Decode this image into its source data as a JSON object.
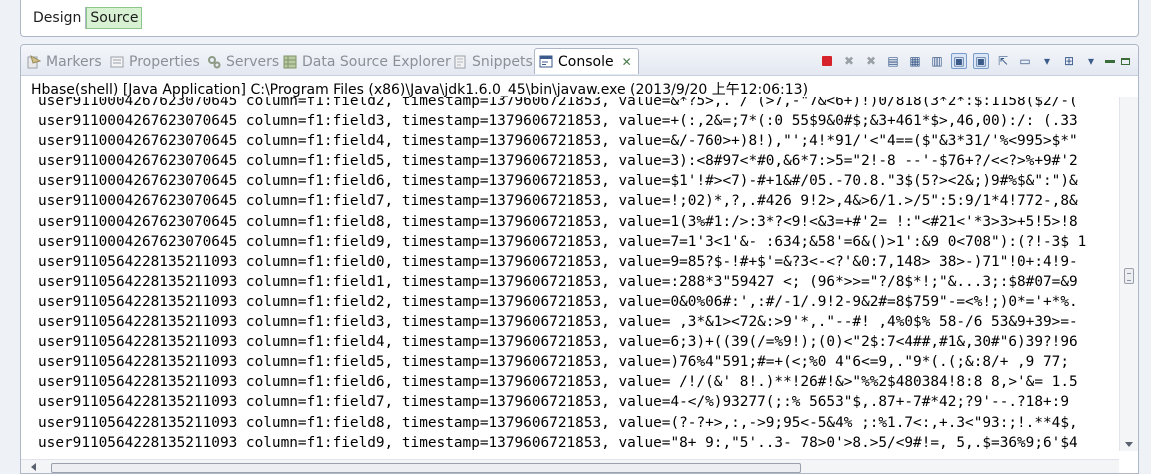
{
  "editor": {
    "tabs": [
      "Design",
      "Source"
    ],
    "active_tab": "Source"
  },
  "view_tabs": [
    {
      "label": "Markers",
      "icon": "markers-icon"
    },
    {
      "label": "Properties",
      "icon": "properties-icon"
    },
    {
      "label": "Servers",
      "icon": "servers-icon"
    },
    {
      "label": "Data Source Explorer",
      "icon": "data-source-explorer-icon"
    },
    {
      "label": "Snippets",
      "icon": "snippets-icon"
    },
    {
      "label": "Console",
      "icon": "console-icon",
      "active": true
    }
  ],
  "console": {
    "launch_title": "Hbase(shell) [Java Application] C:\\Program Files (x86)\\Java\\jdk1.6.0_45\\bin\\javaw.exe (2013/9/20 上午12:06:13)",
    "lines": [
      "user9110004267623070645 column=f1:field2, timestamp=1379606721853, value=&*?5>,. /`(>7,-\"7&<6+)!)0/818(3*2*:$:1158($2/-(",
      "user9110004267623070645 column=f1:field3, timestamp=1379606721853, value=+(:,2&=;7*(:0 55$9&0#$;&3+461*$>,46,00):/: (.33",
      "user9110004267623070645 column=f1:field4, timestamp=1379606721853, value=&/-760>+)8!),\"';4!*91/'<\"4==($\"&3*31/'%<995>$*\"",
      "user9110004267623070645 column=f1:field5, timestamp=1379606721853, value=3):<8#97<*#0,&6*7:>5=\"2!-8 --'-$76+?/<<?>%+9#'2",
      "user9110004267623070645 column=f1:field6, timestamp=1379606721853, value=$1'!#><7)-#+1&#/05.-70.8.\"3$(5?><2&;)9#%$&\":\")&",
      "user9110004267623070645 column=f1:field7, timestamp=1379606721853, value=!;02)*,?,.#426 9!2>,4&>6/1.>/5\":5:9/1*4!772-,8&",
      "user9110004267623070645 column=f1:field8, timestamp=1379606721853, value=1(3%#1:/>:3*?<9!<&3=+#'2= !:\"<#21<'*3>3>+5!5>!8",
      "user9110004267623070645 column=f1:field9, timestamp=1379606721853, value=7=1'3<1'&- :634;&58'=6&()>1':&9 0<708\"):(?!-3$ 1",
      "user9110564228135211093 column=f1:field0, timestamp=1379606721853, value=9=85?$-!#+$'=&?3<-<?'&0:7,148> 38>-)71\"!0+:4!9-",
      "user9110564228135211093 column=f1:field1, timestamp=1379606721853, value=:288*3\"59427 <; (96*>>=\"?/8$*!;\"&...3;:$8#07=&9",
      "user9110564228135211093 column=f1:field2, timestamp=1379606721853, value=0&0%06#:',:#/-1/.9!2-9&2#=8$759\"-=<%!;)0*='+*%.",
      "user9110564228135211093 column=f1:field3, timestamp=1379606721853, value= ,3*&1><72&:>9'*,.\"--#! ,4%0$% 58-/6 53&9+39>=-",
      "user9110564228135211093 column=f1:field4, timestamp=1379606721853, value=6;3)+((39(/=%9!);(0)<\"2$:7<4##,#1&,30#\"6)39?!96",
      "user9110564228135211093 column=f1:field5, timestamp=1379606721853, value=)76%4\"591;#=+(<;%0 4\"6<=9,.\"9*(.(;&:8/+ ,9 77;",
      "user9110564228135211093 column=f1:field6, timestamp=1379606721853, value= /!/(&' 8!.)**!26#!&>\"%%2$480384!8:8 8,>'&= 1.5",
      "user9110564228135211093 column=f1:field7, timestamp=1379606721853, value=4-</%)93277(;:% 5653\"$,.87+-7#*42;?9'--.?18+:9",
      "user9110564228135211093 column=f1:field8, timestamp=1379606721853, value=(?-?+>,:,->9;95<-5&4% ;:%1.7<:,+.3<\"93:;!.**4$,",
      "user9110564228135211093 column=f1:field9, timestamp=1379606721853, value=\"8+ 9:,\"5'..3- 78>0'>8.>5/<9#!=, 5,.$=36%9;6'$4"
    ]
  }
}
